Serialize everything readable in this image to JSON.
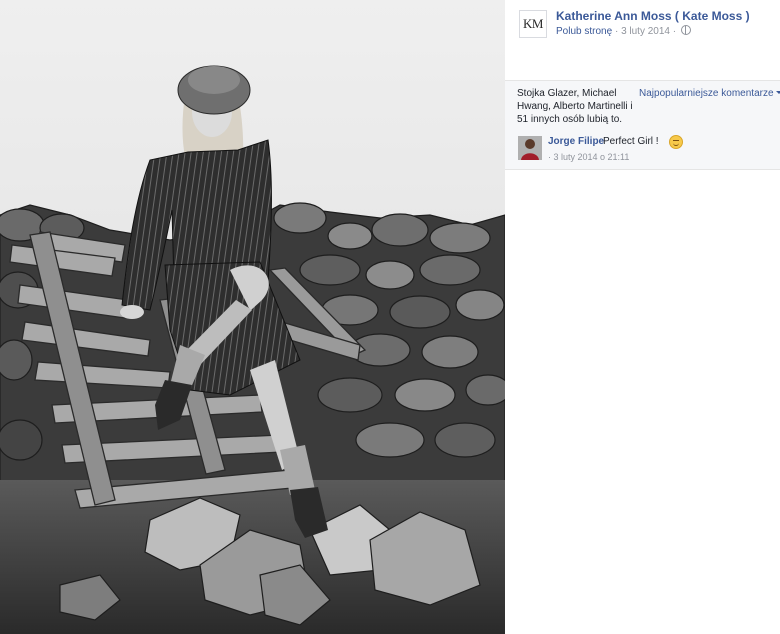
{
  "post": {
    "page_avatar_text": "KM",
    "page_name": "Katherine Ann Moss ( Kate Moss )",
    "like_page_link": "Polub stronę",
    "separator": "·",
    "date": "3 luty 2014",
    "audience_icon": "globe-icon"
  },
  "reactions": {
    "likes_text": "Stojka Glazer, Michael Hwang, Alberto Martinelli i 51 innych osób lubią to.",
    "sort_label": "Najpopularniejsze komentarze"
  },
  "comments": [
    {
      "author": "Jorge Filipe",
      "text": "Perfect Girl !",
      "emoji": "smiling-face-icon",
      "time": "· 3 luty 2014 o 21:11"
    }
  ],
  "colors": {
    "link_blue": "#3b5998",
    "meta_gray": "#90949c",
    "panel_gray": "#f6f7f9"
  }
}
